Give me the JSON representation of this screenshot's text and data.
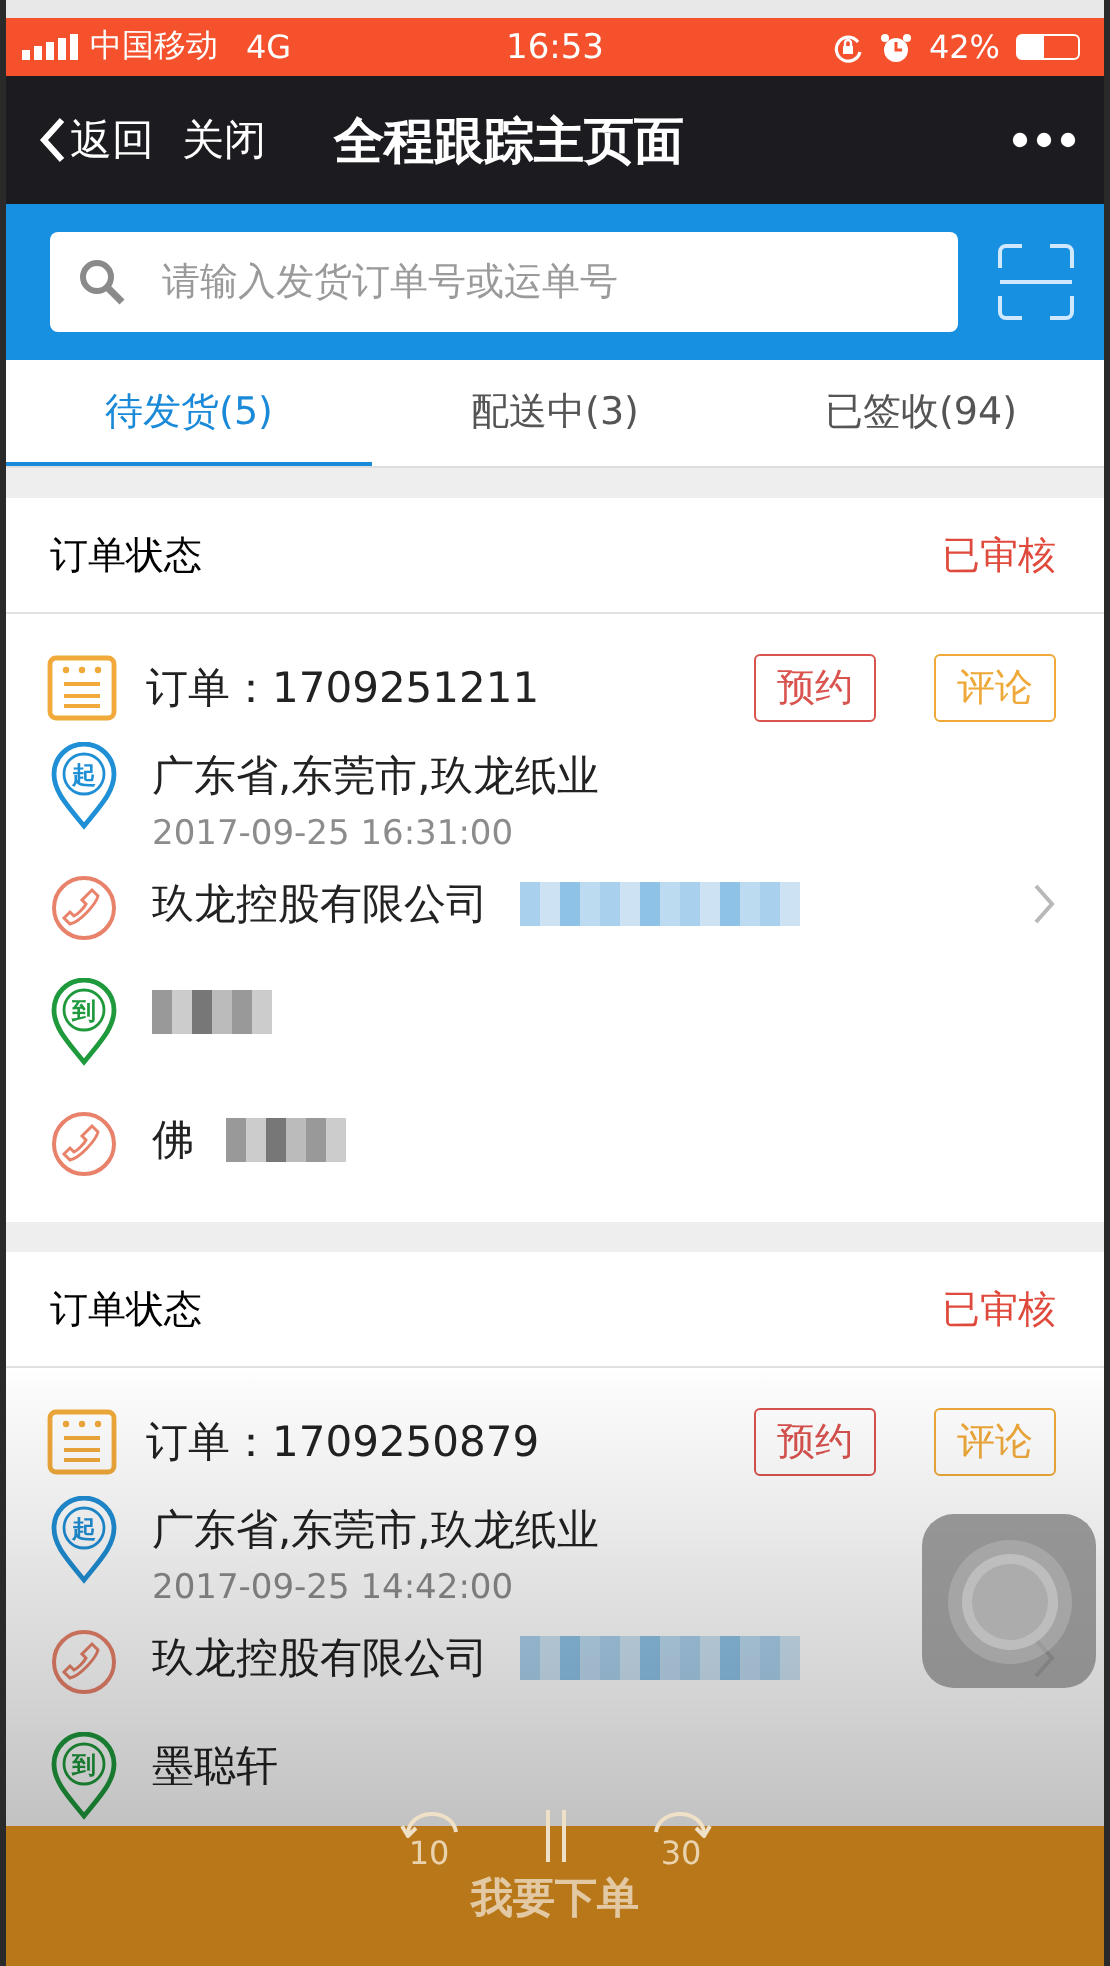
{
  "status_bar": {
    "carrier": "中国移动",
    "network": "4G",
    "time": "16:53",
    "battery": "42%"
  },
  "nav": {
    "back": "返回",
    "close": "关闭",
    "title": "全程跟踪主页面"
  },
  "search": {
    "placeholder": "请输入发货订单号或运单号"
  },
  "tabs": [
    {
      "label": "待发货(5)",
      "selected": true
    },
    {
      "label": "配送中(3)",
      "selected": false
    },
    {
      "label": "已签收(94)",
      "selected": false
    }
  ],
  "orders": [
    {
      "status_label": "订单状态",
      "status": "已审核",
      "order": "订单：1709251211",
      "actions": [
        {
          "label": "预约",
          "color": "#d9534f"
        },
        {
          "label": "评论",
          "color": "#efa93a"
        }
      ],
      "rows": [
        {
          "kind": "origin",
          "pin": "起",
          "text": "广东省,东莞市,玖龙纸业",
          "time": "2017-09-25 16:31:00"
        },
        {
          "kind": "contact",
          "text": "玖龙控股有限公司",
          "blurred": true
        },
        {
          "kind": "destination",
          "pin": "到",
          "blurred": true
        },
        {
          "kind": "contact",
          "text": "佛",
          "blurred": true
        }
      ]
    },
    {
      "status_label": "订单状态",
      "status": "已审核",
      "order": "订单：1709250879",
      "actions": [
        {
          "label": "预约",
          "color": "#d9534f"
        },
        {
          "label": "评论",
          "color": "#efa93a"
        }
      ],
      "rows": [
        {
          "kind": "origin",
          "pin": "起",
          "text": "广东省,东莞市,玖龙纸业",
          "time": "2017-09-25 14:42:00"
        },
        {
          "kind": "contact",
          "text": "玖龙控股有限公司",
          "blurred": true
        },
        {
          "kind": "destination",
          "pin": "到",
          "text": "墨聪轩"
        }
      ]
    }
  ],
  "player": {
    "rewind": "10",
    "forward": "30"
  },
  "order_button": "我要下单"
}
